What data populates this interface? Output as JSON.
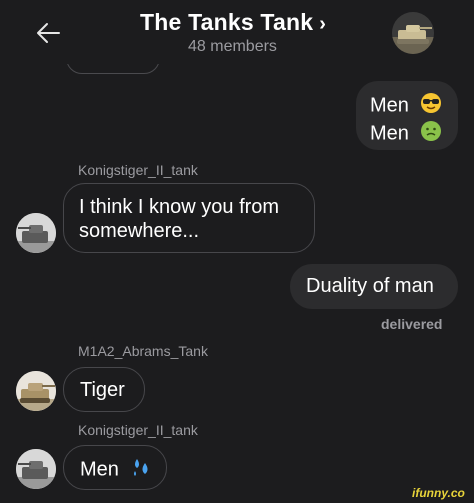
{
  "header": {
    "back_icon": "arrow-left-icon",
    "title": "The Tanks Tank",
    "title_chevron": "›",
    "member_count": "48 members"
  },
  "messages": [
    {
      "direction": "outgoing",
      "lines": [
        "Men",
        "Men"
      ],
      "emojis": [
        "sunglasses-face-emoji",
        "nauseated-face-emoji"
      ]
    },
    {
      "direction": "incoming",
      "sender": "Konigstiger_II_tank",
      "lines": [
        "I think I know you from",
        "somewhere..."
      ]
    },
    {
      "direction": "outgoing",
      "text": "Duality of man",
      "status": "delivered"
    },
    {
      "direction": "incoming",
      "sender": "M1A2_Abrams_Tank",
      "text": "Tiger"
    },
    {
      "direction": "incoming",
      "sender": "Konigstiger_II_tank",
      "text": "Men",
      "emoji": "sweat-droplets-emoji"
    }
  ],
  "watermark": "ifunny.co",
  "colors": {
    "background": "#1c1c1e",
    "outgoing_bubble": "#2c2c2e",
    "incoming_border": "#47474b",
    "muted_text": "#9b9ba0",
    "watermark": "#e8d43a"
  }
}
